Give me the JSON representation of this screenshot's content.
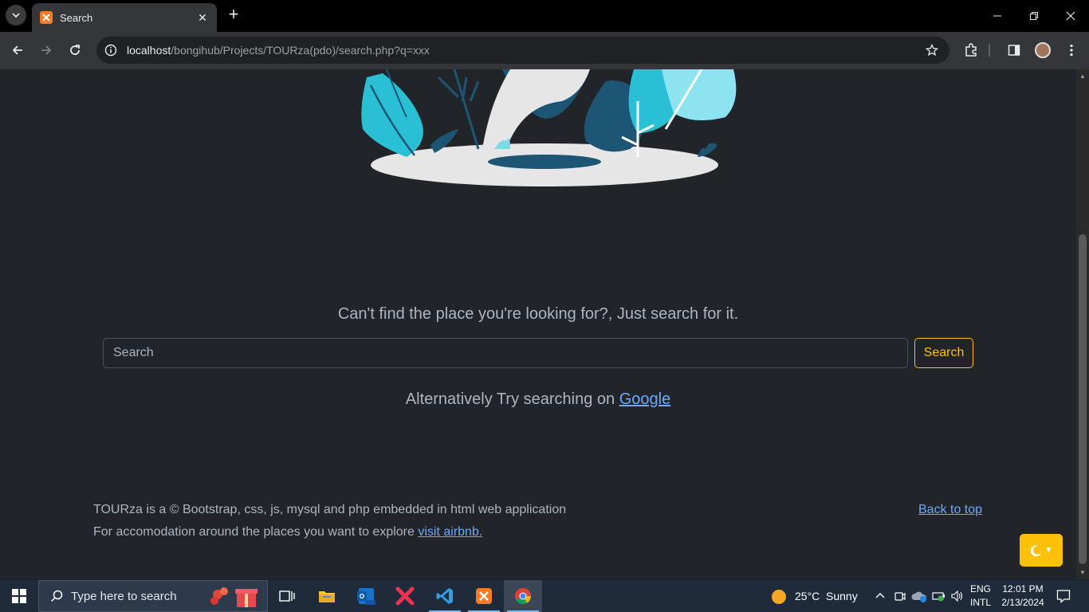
{
  "browser": {
    "tab_title": "Search",
    "url_host": "localhost",
    "url_path": "/bongihub/Projects/TOURza(pdo)/search.php?q=xxx"
  },
  "page": {
    "prompt": "Can't find the place you're looking for?, Just search for it.",
    "search_placeholder": "Search",
    "search_button": "Search",
    "alt_prefix": "Alternatively Try searching on ",
    "alt_link": "Google",
    "footer_line1": "TOURza is a © Bootstrap, css, js, mysql and php embedded in html web application",
    "footer_line2_prefix": "For accomodation around the places you want to explore ",
    "footer_line2_link": "visit airbnb.",
    "back_to_top": "Back to top"
  },
  "taskbar": {
    "search_placeholder": "Type here to search",
    "weather_temp": "25°C",
    "weather_desc": "Sunny",
    "lang_top": "ENG",
    "lang_bottom": "INTL",
    "time": "12:01 PM",
    "date": "2/13/2024"
  },
  "colors": {
    "page_bg": "#212529",
    "accent_warning": "#ffc107",
    "link": "#6ea8fe"
  }
}
